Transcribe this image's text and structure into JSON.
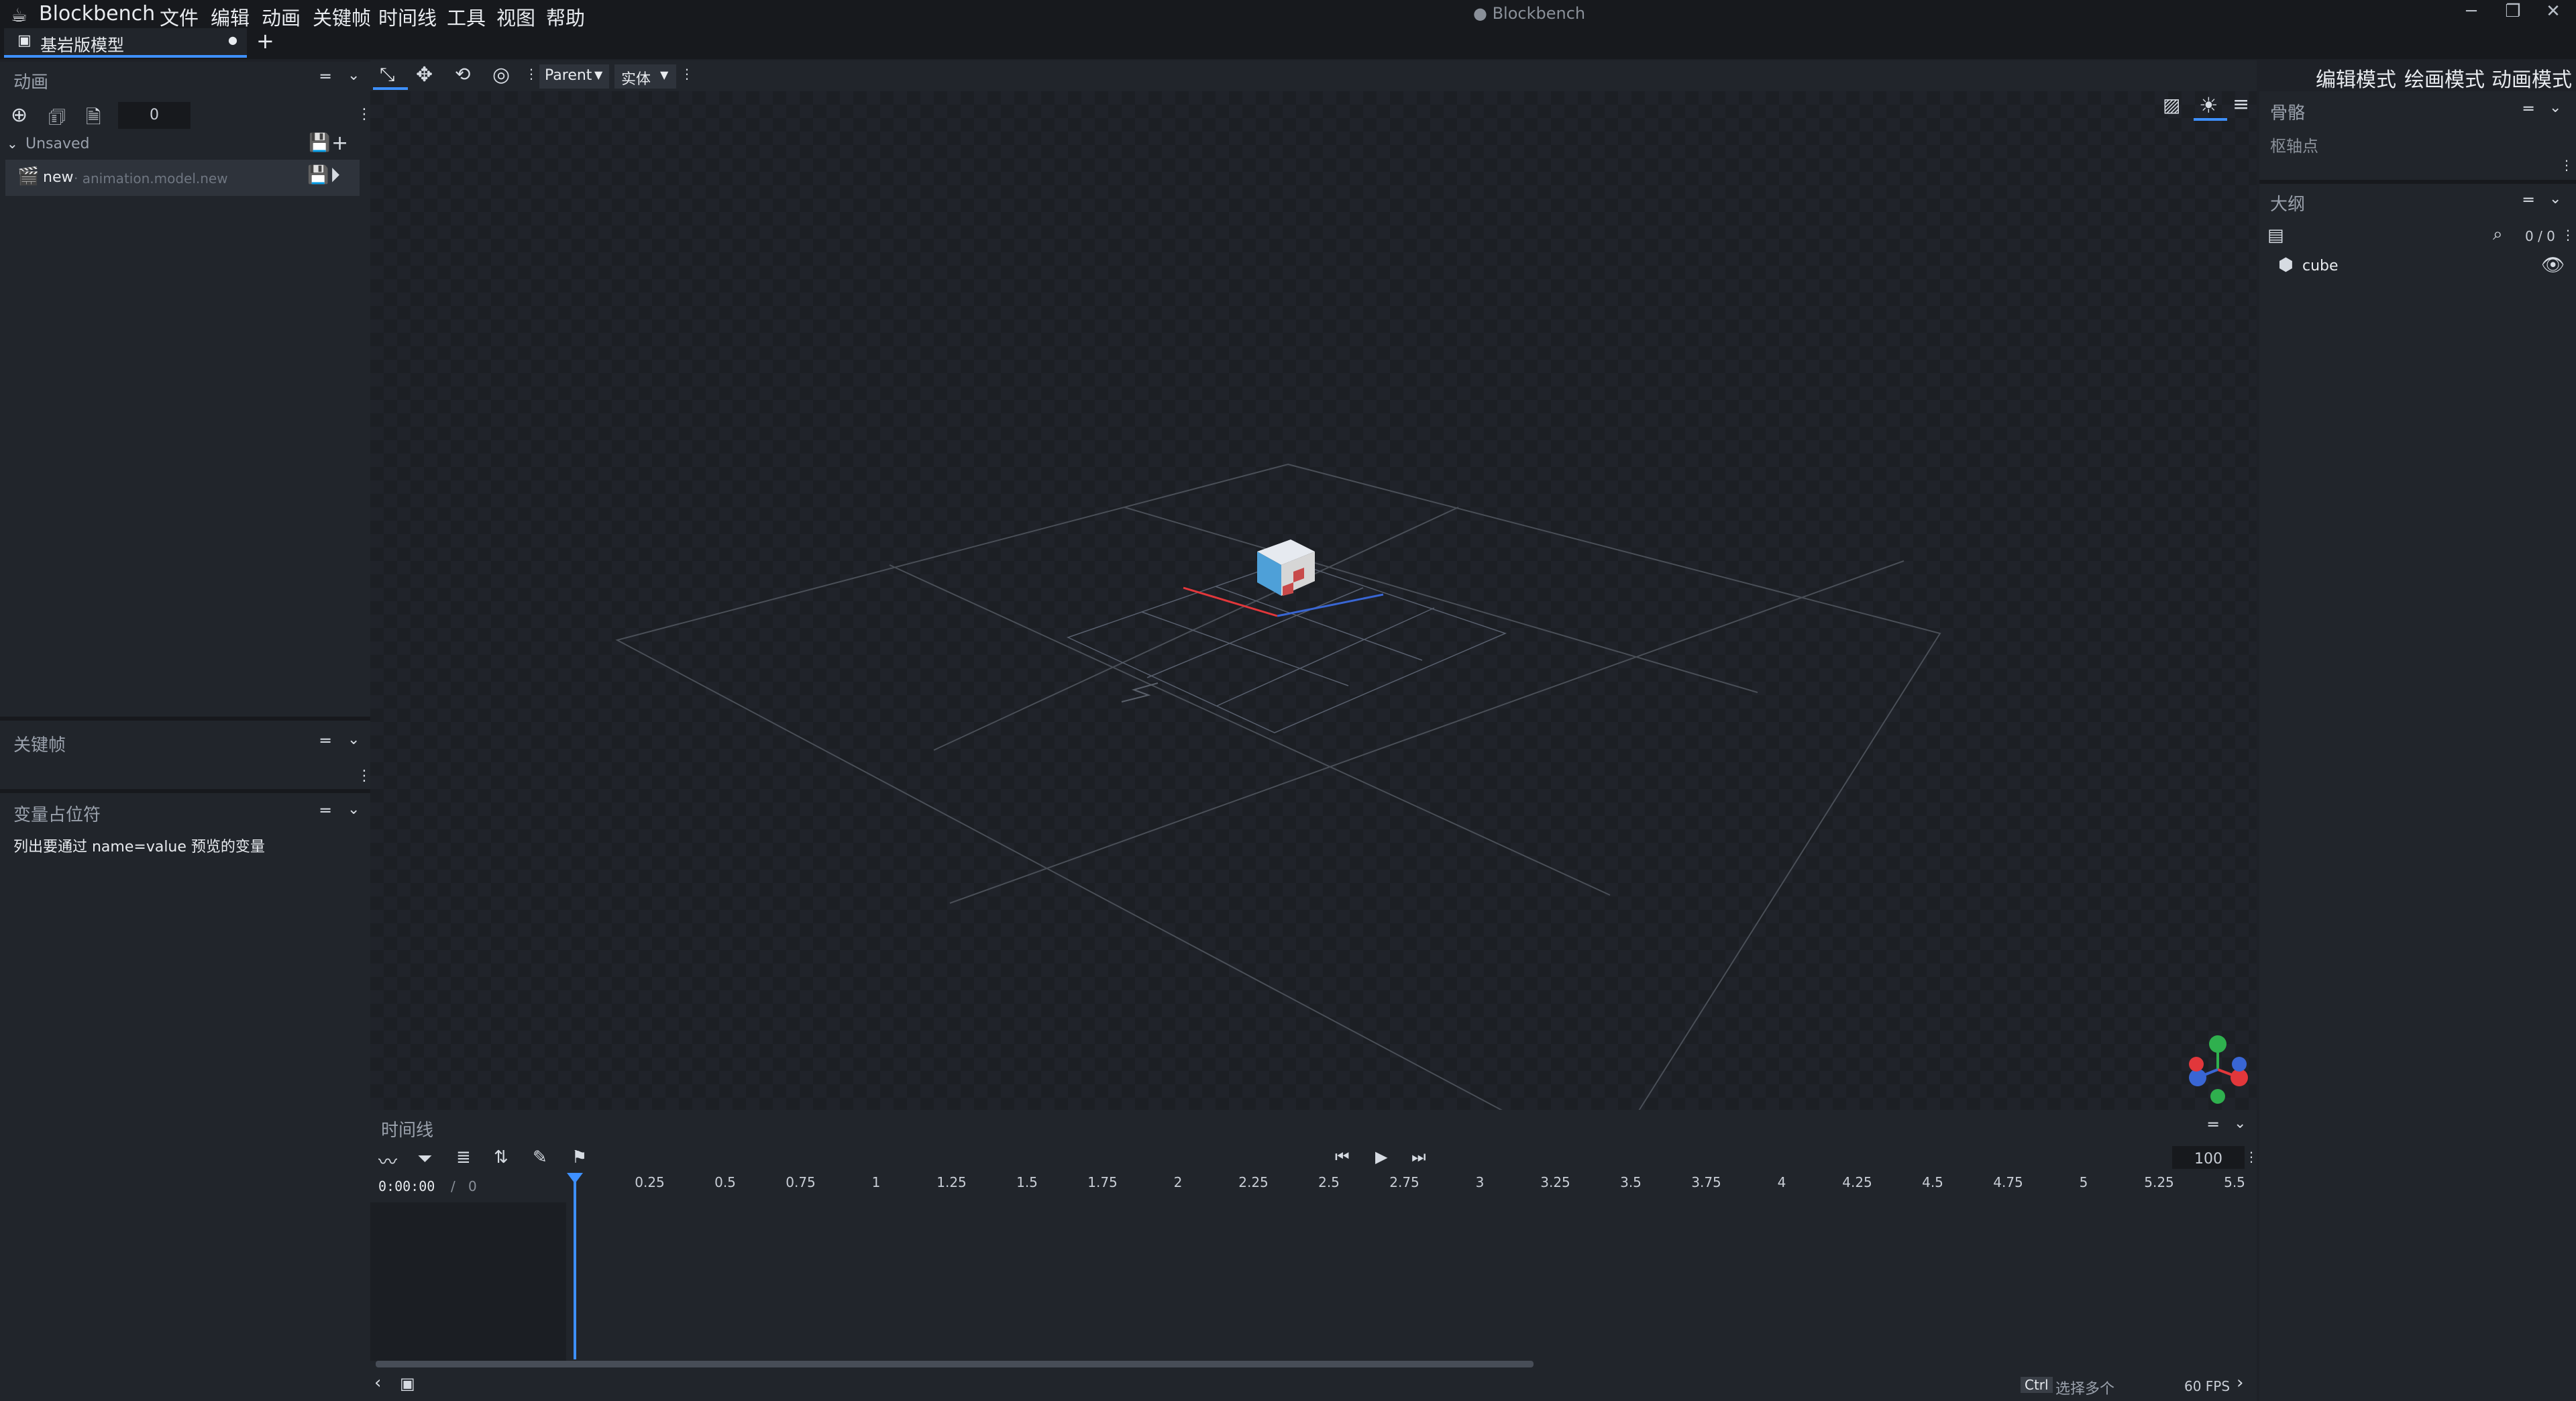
{
  "app": {
    "name": "Blockbench",
    "window_title": "● Blockbench"
  },
  "menu": [
    "文件",
    "编辑",
    "动画",
    "关键帧",
    "时间线",
    "工具",
    "视图",
    "帮助"
  ],
  "window_controls": {
    "minimize": "─",
    "maximize": "❐",
    "close": "✕"
  },
  "tabs": {
    "project": "基岩版模型",
    "unsaved_dot": "●",
    "new_tab": "+"
  },
  "toolbar": {
    "parent_select": "Parent",
    "entity_select": "实体"
  },
  "modes": {
    "edit": "编辑模式",
    "paint": "绘画模式",
    "animate": "动画模式"
  },
  "animations_panel": {
    "title": "动画",
    "counter": "0",
    "group_label": "Unsaved",
    "item_name": "new",
    "item_path": " · animation.model.new"
  },
  "keyframe_panel": {
    "title": "关键帧"
  },
  "variable_panel": {
    "title": "变量占位符",
    "hint": "列出要通过 name=value 预览的变量"
  },
  "bone_panel": {
    "title": "骨骼",
    "pivot_label": "枢轴点"
  },
  "outliner": {
    "title": "大纲",
    "count": "0 / 0",
    "cube_label": "cube"
  },
  "timeline": {
    "title": "时间线",
    "time_display": "0:00:00",
    "time_sep": "/",
    "time_total": "0",
    "zoom_value": "100",
    "ticks": [
      "0.25",
      "0.5",
      "0.75",
      "1",
      "1.25",
      "1.5",
      "1.75",
      "2",
      "2.25",
      "2.5",
      "2.75",
      "3",
      "3.25",
      "3.5",
      "3.75",
      "4",
      "4.25",
      "4.5",
      "4.75",
      "5",
      "5.25",
      "5.5"
    ]
  },
  "status_bar": {
    "ctrl_key": "Ctrl",
    "ctrl_hint": "选择多个",
    "fps": "60 FPS"
  },
  "colors": {
    "accent": "#3e90ff",
    "axis_x": "#e2373b",
    "axis_y": "#2fb04e",
    "axis_z": "#3966d4"
  },
  "icons": [
    "blockbench-logo-icon",
    "plus-circle-icon",
    "import-icon",
    "file-icon",
    "save-icon",
    "plus-icon",
    "film-icon",
    "play-circle-icon",
    "search-icon",
    "eye-icon",
    "cube-icon",
    "graph-icon",
    "filter-icon",
    "list-icon",
    "sort-icon",
    "pencil-icon",
    "flag-icon",
    "skip-start-icon",
    "play-icon",
    "skip-end-icon",
    "chevron-left-icon",
    "model-icon",
    "image-icon",
    "sun-icon",
    "hamburger-icon",
    "chevron-right-icon"
  ]
}
